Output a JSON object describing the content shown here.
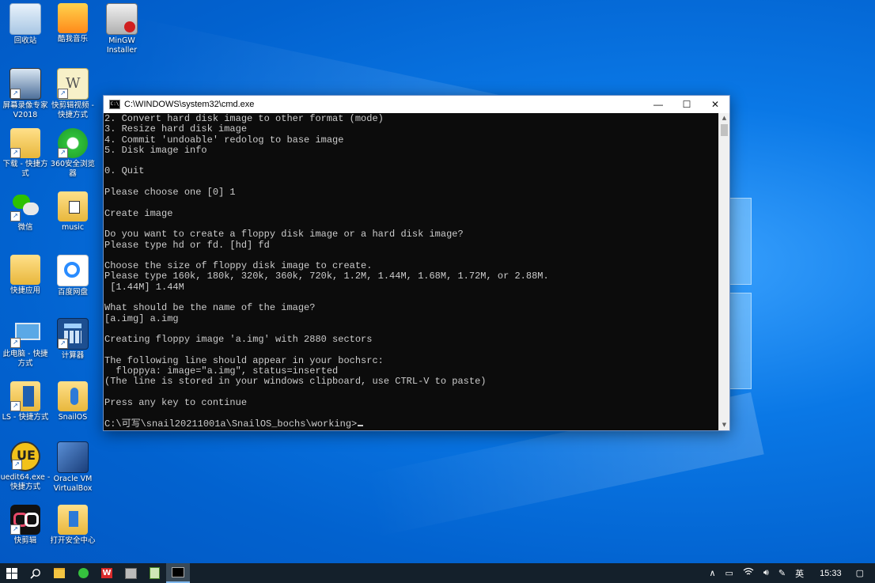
{
  "desktop": {
    "icons": [
      {
        "label": "回收站"
      },
      {
        "label": "酷我音乐"
      },
      {
        "label": "MinGW Installer"
      },
      {
        "label": "屏幕录像专家 V2018"
      },
      {
        "label": "快剪辑视频 - 快捷方式"
      },
      {
        "label": "下载 - 快捷方式"
      },
      {
        "label": "360安全浏览器"
      },
      {
        "label": "微信"
      },
      {
        "label": "music"
      },
      {
        "label": "快捷应用"
      },
      {
        "label": "百度网盘"
      },
      {
        "label": "此电脑 - 快捷方式"
      },
      {
        "label": "计算器"
      },
      {
        "label": "LS - 快捷方式"
      },
      {
        "label": "SnailOS"
      },
      {
        "label": "uedit64.exe - 快捷方式"
      },
      {
        "label": "Oracle VM VirtualBox"
      },
      {
        "label": "快剪辑"
      },
      {
        "label": "打开安全中心"
      }
    ]
  },
  "cmd": {
    "title": "C:\\WINDOWS\\system32\\cmd.exe",
    "icon_text": "C:\\",
    "controls": {
      "minimize": "—",
      "maximize": "☐",
      "close": "✕"
    },
    "lines": [
      "2. Convert hard disk image to other format (mode)",
      "3. Resize hard disk image",
      "4. Commit 'undoable' redolog to base image",
      "5. Disk image info",
      "",
      "0. Quit",
      "",
      "Please choose one [0] 1",
      "",
      "Create image",
      "",
      "Do you want to create a floppy disk image or a hard disk image?",
      "Please type hd or fd. [hd] fd",
      "",
      "Choose the size of floppy disk image to create.",
      "Please type 160k, 180k, 320k, 360k, 720k, 1.2M, 1.44M, 1.68M, 1.72M, or 2.88M.",
      " [1.44M] 1.44M",
      "",
      "What should be the name of the image?",
      "[a.img] a.img",
      "",
      "Creating floppy image 'a.img' with 2880 sectors",
      "",
      "The following line should appear in your bochsrc:",
      "  floppya: image=\"a.img\", status=inserted",
      "(The line is stored in your windows clipboard, use CTRL-V to paste)",
      "",
      "Press any key to continue",
      ""
    ],
    "prompt": "C:\\可写\\snail20211001a\\SnailOS_bochs\\working>"
  },
  "taskbar": {
    "start_icon": "windows-start",
    "buttons": [
      "search",
      "file-explorer",
      "360-browser",
      "wps",
      "mingw",
      "notepad",
      "cmd"
    ],
    "tray": {
      "chevron": "∧",
      "ime": "英",
      "time": "15:33"
    }
  },
  "colors": {
    "desktop": "#0a78e6",
    "console_bg": "#0c0c0c",
    "console_fg": "#cccccc",
    "taskbar": "#14202b"
  }
}
